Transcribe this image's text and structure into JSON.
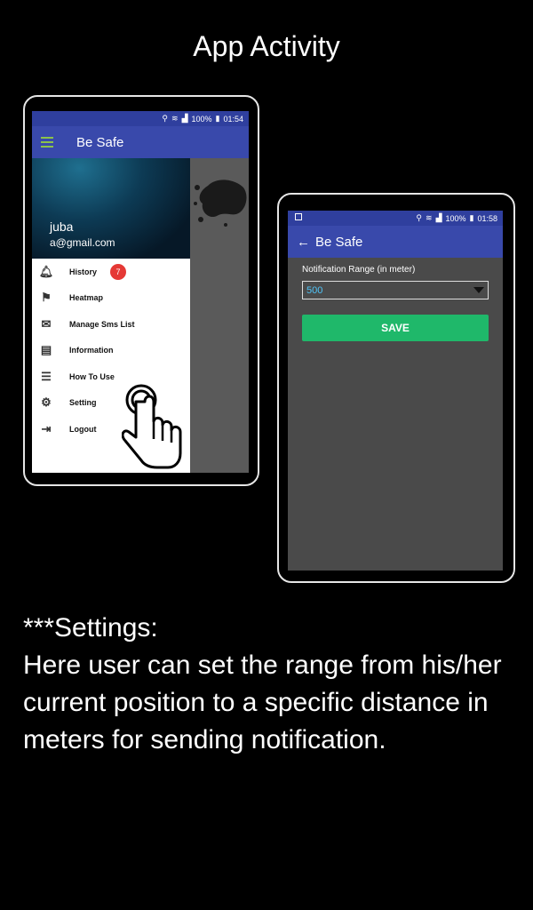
{
  "page": {
    "title": "App Activity",
    "caption_heading": "***Settings:",
    "caption_body": "Here user can  set the range from his/her current position to a specific distance in meters for sending notification."
  },
  "phone_left": {
    "status": {
      "signal": "100%",
      "time": "01:54"
    },
    "appbar": {
      "title": "Be Safe",
      "menu_icon": "hamburger-icon"
    },
    "drawer": {
      "user_name": "juba",
      "user_email": "a@gmail.com",
      "items": [
        {
          "label": "History",
          "icon": "bell-icon",
          "badge": "7"
        },
        {
          "label": "Heatmap",
          "icon": "flag-icon"
        },
        {
          "label": "Manage Sms List",
          "icon": "sms-icon"
        },
        {
          "label": "Information",
          "icon": "info-book-icon"
        },
        {
          "label": "How To Use",
          "icon": "guide-icon"
        },
        {
          "label": "Setting",
          "icon": "gear-icon"
        },
        {
          "label": "Logout",
          "icon": "logout-icon"
        }
      ]
    }
  },
  "phone_right": {
    "status": {
      "signal": "100%",
      "time": "01:58"
    },
    "appbar": {
      "title": "Be Safe",
      "back_icon": "back-arrow-icon"
    },
    "settings": {
      "range_label": "Notification Range (in meter)",
      "range_value": "500",
      "save_label": "SAVE"
    }
  },
  "colors": {
    "appbar": "#3949ab",
    "statusbar": "#2f3f9e",
    "save_button": "#1fb86a",
    "badge": "#e53935",
    "menu_icon": "#8bc34a"
  }
}
